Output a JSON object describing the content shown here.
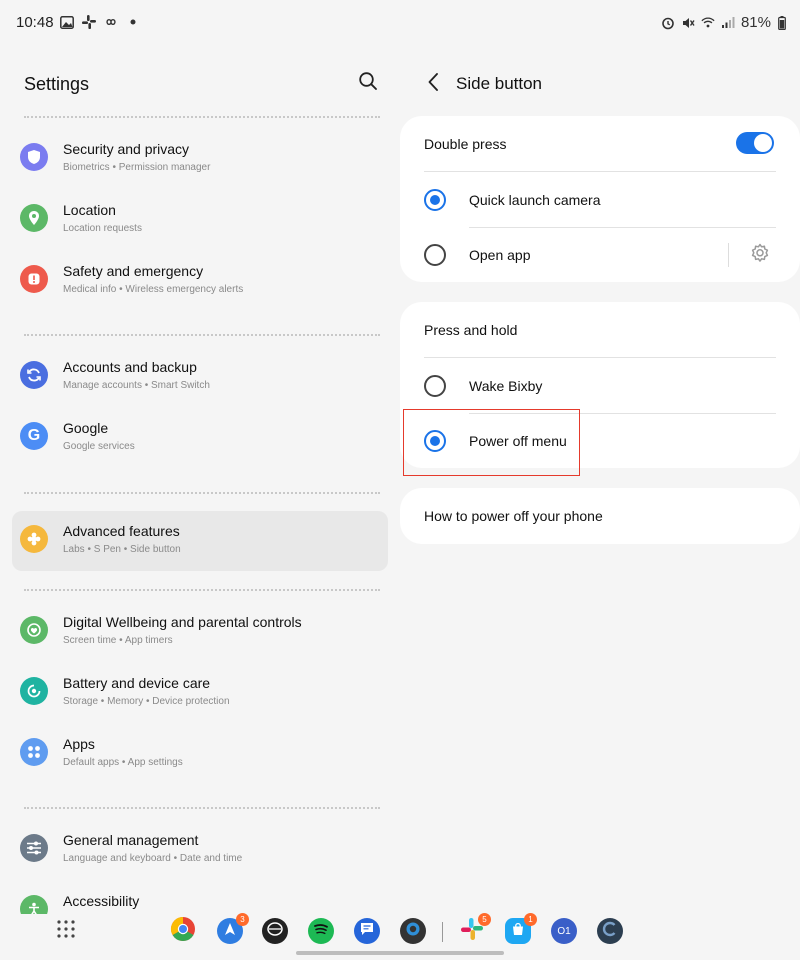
{
  "status_bar": {
    "time": "10:48",
    "left_icons": [
      "gallery-icon",
      "slack-icon",
      "infinity-icon",
      "dot-icon"
    ],
    "right_icons": [
      "alarm-icon",
      "mute-icon",
      "wifi-icon",
      "signal-icon"
    ],
    "battery": "81%"
  },
  "settings": {
    "title": "Settings",
    "items": [
      {
        "title": "Security and privacy",
        "subtitle": "Biometrics  •  Permission manager",
        "color": "#7b7cf0",
        "icon": "shield-icon"
      },
      {
        "title": "Location",
        "subtitle": "Location requests",
        "color": "#5cb867",
        "icon": "location-pin-icon"
      },
      {
        "title": "Safety and emergency",
        "subtitle": "Medical info  •  Wireless emergency alerts",
        "color": "#ee5a4c",
        "icon": "alert-icon"
      },
      {
        "title": "Accounts and backup",
        "subtitle": "Manage accounts  •  Smart Switch",
        "color": "#4a6ee0",
        "icon": "sync-icon"
      },
      {
        "title": "Google",
        "subtitle": "Google services",
        "color": "#4c8df5",
        "icon": "google-icon"
      },
      {
        "title": "Advanced features",
        "subtitle": "Labs  •  S Pen  •  Side button",
        "color": "#f5b83d",
        "icon": "puzzle-icon"
      },
      {
        "title": "Digital Wellbeing and parental controls",
        "subtitle": "Screen time  •  App timers",
        "color": "#5cb867",
        "icon": "wellbeing-icon"
      },
      {
        "title": "Battery and device care",
        "subtitle": "Storage  •  Memory  •  Device protection",
        "color": "#1fb3a1",
        "icon": "battery-care-icon"
      },
      {
        "title": "Apps",
        "subtitle": "Default apps  •  App settings",
        "color": "#5f9cf0",
        "icon": "apps-grid-icon"
      },
      {
        "title": "General management",
        "subtitle": "Language and keyboard  •  Date and time",
        "color": "#6c7a89",
        "icon": "sliders-icon"
      },
      {
        "title": "Accessibility",
        "subtitle": "",
        "color": "#5cb867",
        "icon": "accessibility-icon"
      }
    ]
  },
  "side_button": {
    "title": "Side button",
    "double_press": {
      "label": "Double press",
      "toggle_on": true,
      "options": [
        "Quick launch camera",
        "Open app"
      ],
      "selected": "Quick launch camera"
    },
    "press_hold": {
      "label": "Press and hold",
      "options": [
        "Wake Bixby",
        "Power off menu"
      ],
      "selected": "Power off menu"
    },
    "help_link": "How to power off your phone"
  },
  "dock": {
    "apps": [
      {
        "name": "chrome",
        "badge": ""
      },
      {
        "name": "arrow-nav",
        "badge": "3"
      },
      {
        "name": "dark-app",
        "badge": ""
      },
      {
        "name": "spotify",
        "badge": ""
      },
      {
        "name": "messages",
        "badge": ""
      },
      {
        "name": "circle-app",
        "badge": ""
      },
      {
        "name": "slack",
        "badge": "5"
      },
      {
        "name": "store",
        "badge": "1"
      },
      {
        "name": "o1",
        "badge": "",
        "label": "O1"
      },
      {
        "name": "c-app",
        "badge": ""
      }
    ]
  }
}
